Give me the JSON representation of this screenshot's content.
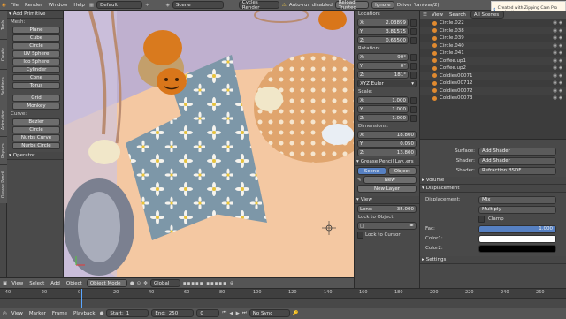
{
  "topbar": {
    "menus": [
      "File",
      "Render",
      "Window",
      "Help"
    ],
    "layout": "Default",
    "scene": "Scene",
    "engine": "Cycles Render",
    "autorun": "Auto-run disabled",
    "reload_trusted": "Reload Trusted",
    "ignore": "Ignore",
    "driver": "Driver 'tan(var/2)'"
  },
  "notification": {
    "text": "Created with Zipping Cam Pro evaluation version"
  },
  "left_tabs": [
    "Tools",
    "Create",
    "Relations",
    "Animation",
    "Physics",
    "Grease Pencil"
  ],
  "toolshelf": {
    "title": "Add Primitive",
    "mesh_label": "Mesh:",
    "mesh": [
      "Plane",
      "Cube",
      "Circle",
      "UV Sphere",
      "Ico Sphere",
      "Cylinder",
      "Cone",
      "Torus"
    ],
    "other": [
      "Grid",
      "Monkey"
    ],
    "curve_label": "Curve:",
    "curve": [
      "Bezier",
      "Circle",
      "Nurbs Curve",
      "Nurbs Circle"
    ],
    "operator": "Operator"
  },
  "viewport_header": {
    "view": "View",
    "select": "Select",
    "add": "Add",
    "object": "Object",
    "mode": "Object Mode",
    "orientation": "Global"
  },
  "npanel": {
    "location_label": "Location:",
    "location": [
      {
        "axis": "X:",
        "value": "2.03899"
      },
      {
        "axis": "Y:",
        "value": "3.81575"
      },
      {
        "axis": "Z:",
        "value": "0.66500"
      }
    ],
    "rotation_label": "Rotation:",
    "rotation": [
      {
        "axis": "X:",
        "value": "90°"
      },
      {
        "axis": "Y:",
        "value": "0°"
      },
      {
        "axis": "Z:",
        "value": "181°"
      }
    ],
    "euler": "XYZ Euler",
    "scale_label": "Scale:",
    "scale": [
      {
        "axis": "X:",
        "value": "1.000"
      },
      {
        "axis": "Y:",
        "value": "1.000"
      },
      {
        "axis": "Z:",
        "value": "1.000"
      }
    ],
    "dimensions_label": "Dimensions:",
    "dimensions": [
      {
        "axis": "X:",
        "value": "18.800"
      },
      {
        "axis": "Y:",
        "value": "0.050"
      },
      {
        "axis": "Z:",
        "value": "13.800"
      }
    ],
    "grease_pencil": "Grease Pencil Lay..ers",
    "scene_tab": "Scene",
    "object_tab": "Object",
    "new": "New",
    "new_layer": "New Layer",
    "view_section": "View",
    "lens_label": "Lens:",
    "lens_value": "35.000",
    "lock_to_object": "Lock to Object:",
    "lock_to_cursor": "Lock to Cursor"
  },
  "outliner": {
    "view": "View",
    "search": "Search",
    "scope": "All Scenes",
    "items": [
      "Circle.022",
      "Circle.038",
      "Circle.039",
      "Circle.040",
      "Circle.041",
      "Coffee.up1",
      "Coffee.up2",
      "Coldies00071",
      "Coldies00712",
      "Coldies00072",
      "Coldies00073"
    ]
  },
  "properties": {
    "surface_label": "Surface:",
    "surface_value": "Add Shader",
    "shader1_label": "Shader:",
    "shader1_value": "Add Shader",
    "shader2_label": "Shader:",
    "shader2_value": "Refraction BSDF",
    "volume": "Volume",
    "displacement_section": "Displacement",
    "displacement_label": "Displacement:",
    "displacement_value": "Mix",
    "multiply": "Multiply",
    "clamp": "Clamp",
    "fac_label": "Fac:",
    "fac_value": "1.000",
    "color1_label": "Color1:",
    "color2_label": "Color2:",
    "settings": "Settings"
  },
  "timeline": {
    "ticks": [
      "-40",
      "-20",
      "0",
      "20",
      "40",
      "60",
      "80",
      "100",
      "120",
      "140",
      "160",
      "180",
      "200",
      "220",
      "240",
      "260"
    ],
    "view": "View",
    "marker": "Marker",
    "frame": "Frame",
    "playback": "Playback",
    "start_label": "Start:",
    "start": "1",
    "end_label": "End:",
    "end": "250",
    "current": "0",
    "sync": "No Sync"
  },
  "colors": {
    "accent": "#5680c2",
    "selected_row": "#f18a24",
    "bg_dark": "#3d3d3d"
  }
}
